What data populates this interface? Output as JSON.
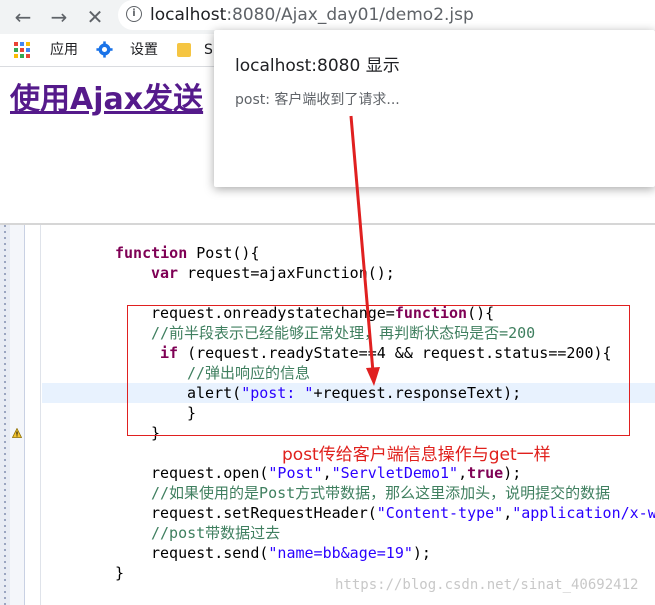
{
  "browser": {
    "url_host": "localhost",
    "url_rest": ":8080/Ajax_day01/demo2.jsp",
    "bookmarks": {
      "apps_label": "应用",
      "settings_label": "设置",
      "folder_label": "S"
    }
  },
  "page": {
    "title": "使用Ajax发送"
  },
  "dialog": {
    "title": "localhost:8080 显示",
    "message": "post: 客户端收到了请求..."
  },
  "code": {
    "lines": [
      "function Post(){",
      "var request=ajaxFunction();",
      "request.onreadystatechange=function(){",
      "//前半段表示已经能够正常处理，再判断状态码是否=200",
      "if (request.readyState==4 && request.status==200){",
      "//弹出响应的信息",
      "alert(\"post: \"+request.responseText);",
      "}",
      "}",
      "request.open(\"Post\",\"ServletDemo1\",true);",
      "//如果使用的是Post方式带数据，那么这里添加头，说明提交的数据",
      "request.setRequestHeader(\"Content-type\",\"application/x-w",
      "//post带数据过去",
      "request.send(\"name=bb&age=19\");",
      "}"
    ]
  },
  "annotation": {
    "note": "post传给客户端信息操作与get一样",
    "watermark": "https://blog.csdn.net/sinat_40692412"
  },
  "colors": {
    "keyword": "#7f0055",
    "comment": "#3f7f5f",
    "string": "#2a00ff",
    "annotation_red": "#e02020",
    "link_purple": "#551a8b"
  }
}
